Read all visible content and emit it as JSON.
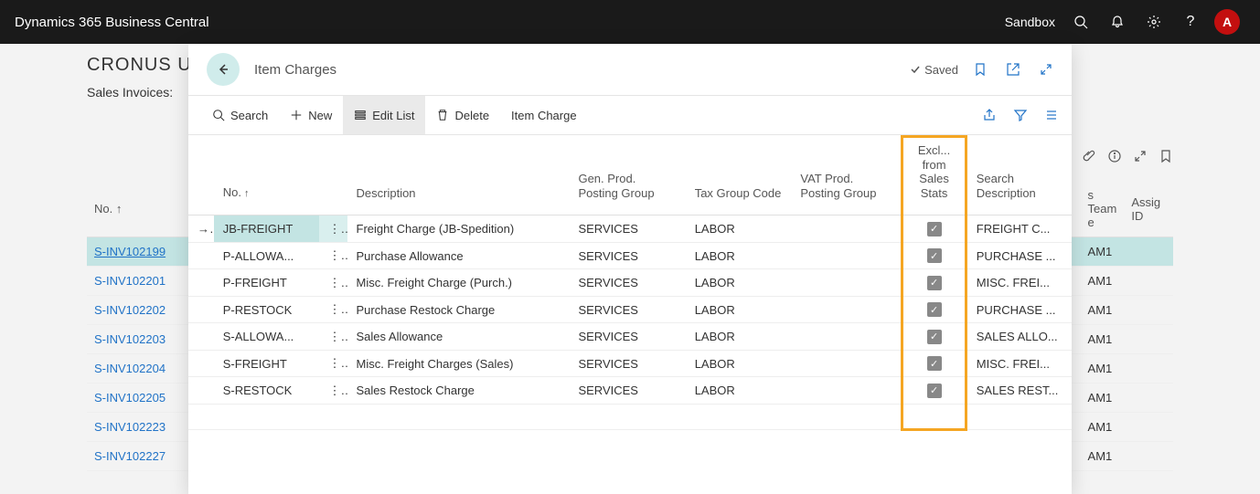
{
  "topbar": {
    "title": "Dynamics 365 Business Central",
    "env": "Sandbox",
    "avatar": "A"
  },
  "background": {
    "company": "CRONUS US",
    "breadcrumb": "Sales Invoices:",
    "columns": {
      "no": "No. ↑",
      "team": "s Team",
      "team2": "e",
      "assig": "Assig",
      "id": "ID"
    },
    "rows": [
      {
        "no": "S-INV102199",
        "team": "AM1",
        "sel": true
      },
      {
        "no": "S-INV102201",
        "team": "AM1"
      },
      {
        "no": "S-INV102202",
        "team": "AM1"
      },
      {
        "no": "S-INV102203",
        "team": "AM1"
      },
      {
        "no": "S-INV102204",
        "team": "AM1"
      },
      {
        "no": "S-INV102205",
        "team": "AM1"
      },
      {
        "no": "S-INV102223",
        "team": "AM1"
      },
      {
        "no": "S-INV102227",
        "team": "AM1"
      }
    ]
  },
  "panel": {
    "title": "Item Charges",
    "saved": "Saved",
    "toolbar": {
      "search": "Search",
      "new": "New",
      "edit": "Edit List",
      "delete": "Delete",
      "itemcharge": "Item Charge"
    },
    "columns": {
      "no": "No.",
      "desc": "Description",
      "gpp": "Gen. Prod. Posting Group",
      "tgc": "Tax Group Code",
      "vpg": "VAT Prod. Posting Group",
      "excl": "Excl... from Sales Stats",
      "sdesc": "Search Description"
    },
    "rows": [
      {
        "no": "JB-FREIGHT",
        "desc": "Freight Charge (JB-Spedition)",
        "gpp": "SERVICES",
        "tgc": "LABOR",
        "vpg": "",
        "excl": true,
        "sdesc": "FREIGHT C...",
        "sel": true
      },
      {
        "no": "P-ALLOWA...",
        "desc": "Purchase Allowance",
        "gpp": "SERVICES",
        "tgc": "LABOR",
        "vpg": "",
        "excl": true,
        "sdesc": "PURCHASE ..."
      },
      {
        "no": "P-FREIGHT",
        "desc": "Misc. Freight Charge (Purch.)",
        "gpp": "SERVICES",
        "tgc": "LABOR",
        "vpg": "",
        "excl": true,
        "sdesc": "MISC. FREI..."
      },
      {
        "no": "P-RESTOCK",
        "desc": "Purchase Restock Charge",
        "gpp": "SERVICES",
        "tgc": "LABOR",
        "vpg": "",
        "excl": true,
        "sdesc": "PURCHASE ..."
      },
      {
        "no": "S-ALLOWA...",
        "desc": "Sales Allowance",
        "gpp": "SERVICES",
        "tgc": "LABOR",
        "vpg": "",
        "excl": true,
        "sdesc": "SALES ALLO..."
      },
      {
        "no": "S-FREIGHT",
        "desc": "Misc. Freight Charges (Sales)",
        "gpp": "SERVICES",
        "tgc": "LABOR",
        "vpg": "",
        "excl": true,
        "sdesc": "MISC. FREI..."
      },
      {
        "no": "S-RESTOCK",
        "desc": "Sales Restock Charge",
        "gpp": "SERVICES",
        "tgc": "LABOR",
        "vpg": "",
        "excl": true,
        "sdesc": "SALES REST..."
      }
    ]
  }
}
